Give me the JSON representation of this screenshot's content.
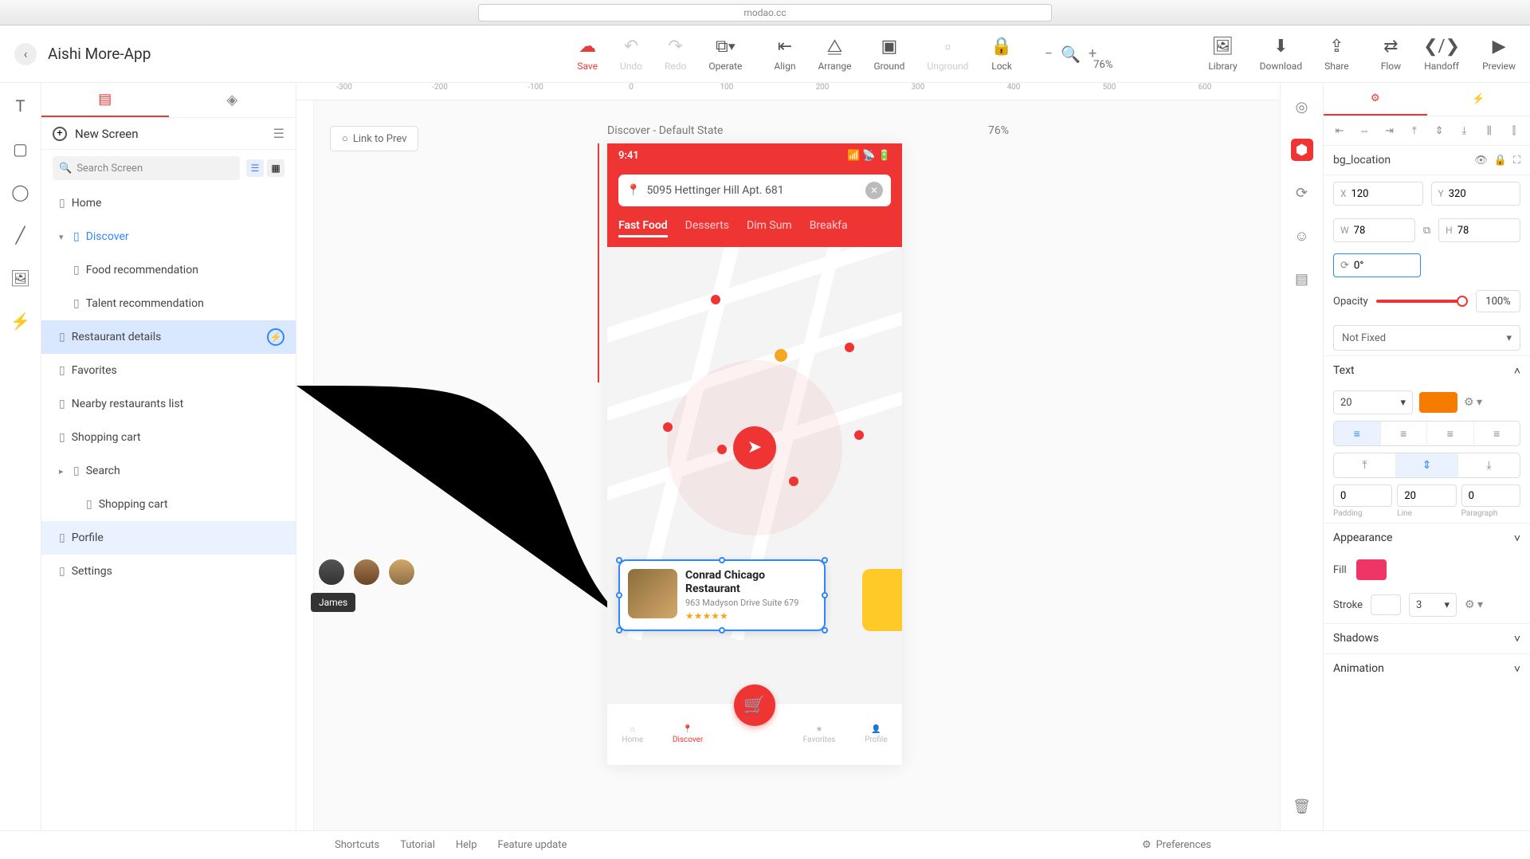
{
  "browser": {
    "url": "modao.cc"
  },
  "project": {
    "title": "Aishi More-App"
  },
  "toolbar": {
    "save": "Save",
    "undo": "Undo",
    "redo": "Redo",
    "operate": "Operate",
    "align": "Align",
    "arrange": "Arrange",
    "ground": "Ground",
    "unground": "Unground",
    "lock": "Lock",
    "zoom": "76%",
    "library": "Library",
    "download": "Download",
    "share": "Share",
    "flow": "Flow",
    "handoff": "Handoff",
    "preview": "Preview"
  },
  "sidebar": {
    "newScreen": "New Screen",
    "searchPlaceholder": "Search Screen",
    "screens": [
      {
        "label": "Home"
      },
      {
        "label": "Discover"
      },
      {
        "label": "Food recommendation"
      },
      {
        "label": "Talent recommendation"
      },
      {
        "label": "Restaurant details"
      },
      {
        "label": "Favorites"
      },
      {
        "label": "Nearby restaurants list"
      },
      {
        "label": "Shopping cart"
      },
      {
        "label": "Search"
      },
      {
        "label": "Shopping cart"
      },
      {
        "label": "Porfile"
      },
      {
        "label": "Settings"
      }
    ]
  },
  "canvas": {
    "linkPrev": "Link to Prev",
    "screenTitle": "Discover - Default State",
    "zoom": "76%",
    "tooltip": "James"
  },
  "device": {
    "time": "9:41",
    "address": "5095 Hettinger Hill Apt. 681",
    "foodTabs": [
      "Fast Food",
      "Desserts",
      "Dim Sum",
      "Breakfa"
    ],
    "restaurant": {
      "name": "Conrad Chicago Restaurant",
      "address": "963 Madyson Drive Suite 679",
      "stars": "★★★★★"
    },
    "tabs": {
      "home": "Home",
      "discover": "Discover",
      "favorites": "Favorites",
      "profile": "Profile"
    }
  },
  "inspector": {
    "elementName": "bg_location",
    "x": "120",
    "y": "320",
    "w": "78",
    "h": "78",
    "rotation": "0°",
    "opacityLabel": "Opacity",
    "opacityVal": "100%",
    "fixed": "Not Fixed",
    "textSection": "Text",
    "fontSize": "20",
    "padding": "0",
    "line": "20",
    "paragraph": "0",
    "paddingL": "Padding",
    "lineL": "Line",
    "paragraphL": "Paragraph",
    "appearance": "Appearance",
    "fill": "Fill",
    "stroke": "Stroke",
    "strokeW": "3",
    "shadows": "Shadows",
    "animation": "Animation",
    "fillColor": "#ef3466",
    "textColor": "#f57c00",
    "strokeColor": "#ffffff"
  },
  "bottom": {
    "shortcuts": "Shortcuts",
    "tutorial": "Tutorial",
    "help": "Help",
    "feature": "Feature update",
    "prefs": "Preferences"
  }
}
